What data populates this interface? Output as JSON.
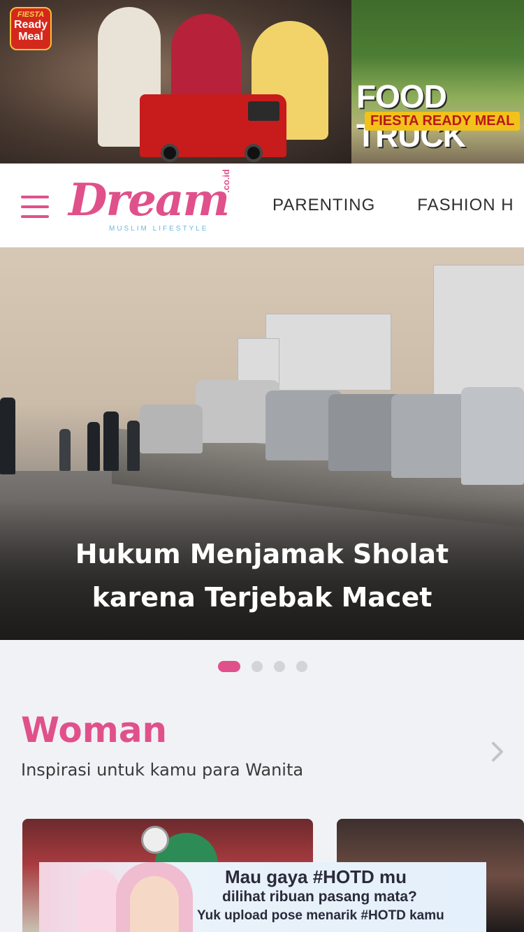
{
  "top_ad": {
    "brand_small": "FIESTA",
    "brand_badge_line1": "Ready",
    "brand_badge_line2": "Meal",
    "headline": "FOOD TRUCK",
    "subline": "FIESTA READY MEAL"
  },
  "header": {
    "brand_name": "Dream",
    "brand_suffix": ".co.id",
    "brand_tagline": "MUSLIM LIFESTYLE",
    "nav": [
      {
        "label": "PARENTING"
      },
      {
        "label": "FASHION H"
      }
    ]
  },
  "hero": {
    "title": "Hukum Menjamak Sholat karena Terjebak Macet"
  },
  "carousel": {
    "active_index": 0,
    "count": 4
  },
  "section": {
    "title": "Woman",
    "subtitle": "Inspirasi untuk kamu para Wanita"
  },
  "bottom_ad": {
    "line1": "Mau gaya #HOTD mu",
    "line2": "dilihat ribuan pasang mata?",
    "line3": "Yuk upload pose menarik #HOTD kamu"
  },
  "colors": {
    "accent": "#e0518b",
    "secondary": "#6cb9df",
    "background": "#f1f2f6"
  }
}
